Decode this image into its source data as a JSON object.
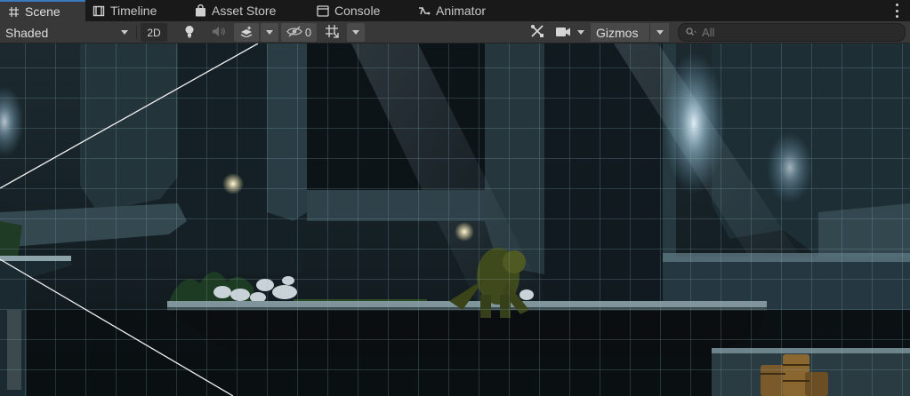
{
  "tabs": [
    {
      "label": "Scene",
      "icon": "scene-grid-icon",
      "active": true
    },
    {
      "label": "Timeline",
      "icon": "timeline-icon",
      "active": false
    },
    {
      "label": "Asset Store",
      "icon": "asset-store-bag-icon",
      "active": false
    },
    {
      "label": "Console",
      "icon": "console-icon",
      "active": false
    },
    {
      "label": "Animator",
      "icon": "animator-icon",
      "active": false
    }
  ],
  "toolbar": {
    "shading_mode": "Shaded",
    "mode_2d_label": "2D",
    "hidden_count": "0",
    "gizmos_label": "Gizmos",
    "search_placeholder": "All"
  },
  "colors": {
    "active_tab_accent": "#3a79bb",
    "toolbar_bg": "#383838",
    "tab_bar_bg": "#191919",
    "grid_line": "#8fb6c0"
  }
}
